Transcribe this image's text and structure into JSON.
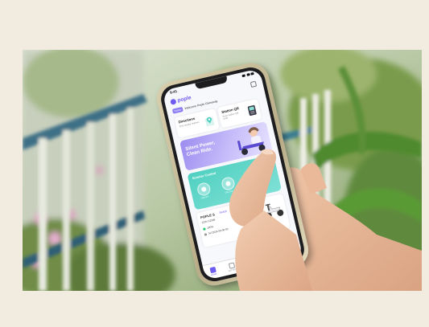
{
  "app": {
    "status_time": "9:41",
    "logo": "pople",
    "notice": {
      "badge": "Notice",
      "text": "Welcome Pople Giveaway"
    },
    "directions": {
      "title": "Directions",
      "subtitle": "Find nearby stations"
    },
    "station": {
      "title": "Station QR",
      "subtitle": "Scan station QR code"
    },
    "banner": {
      "text": "Silent Power, Clean Ride."
    },
    "controls": {
      "title": "Scooter Control",
      "items": [
        {
          "label": "ON/OFF"
        },
        {
          "label": "UNLOCK"
        },
        {
          "label": "FIND ME"
        }
      ]
    },
    "scooter": {
      "name": "POPLE S",
      "switch": "Switch",
      "id": "123V 12348",
      "battery": "100%",
      "date": "Jul 2024 00:00:00"
    },
    "tabs": [
      {
        "label": "HOME",
        "active": true
      },
      {
        "label": "BATTERY",
        "active": false
      },
      {
        "label": "MY RIDE",
        "active": false
      },
      {
        "label": "SUPPORT",
        "active": false
      },
      {
        "label": "MORE",
        "active": false
      }
    ]
  },
  "colors": {
    "accent": "#6f5cf0",
    "teal": "#4fd0c0",
    "frame_bg": "#f1ecdf"
  }
}
